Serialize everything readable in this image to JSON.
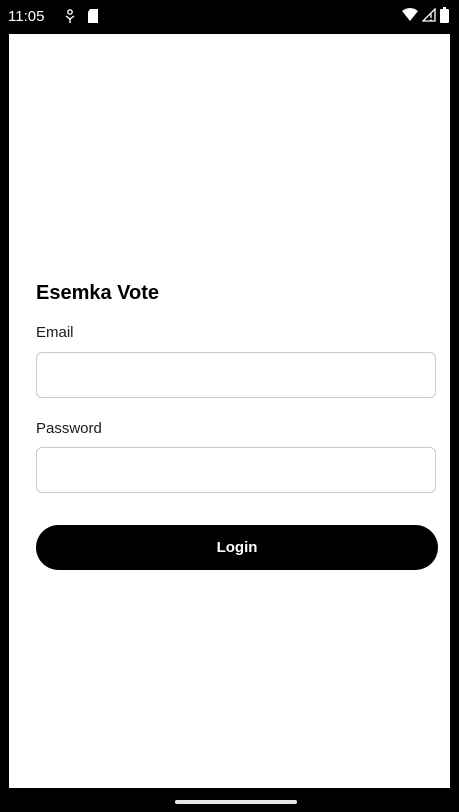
{
  "status_bar": {
    "time": "11:05",
    "icons_left": [
      "usb-debug-icon",
      "sd-card-icon"
    ],
    "icons_right": [
      "wifi-icon",
      "cellular-signal-icon",
      "battery-icon"
    ]
  },
  "app": {
    "title": "Esemka Vote"
  },
  "form": {
    "email_label": "Email",
    "email_value": "",
    "email_placeholder": "",
    "password_label": "Password",
    "password_value": "",
    "password_placeholder": "",
    "login_label": "Login"
  },
  "colors": {
    "background": "#ffffff",
    "accent": "#000000",
    "input_border": "#c9c9c9",
    "button_text": "#ffffff"
  }
}
